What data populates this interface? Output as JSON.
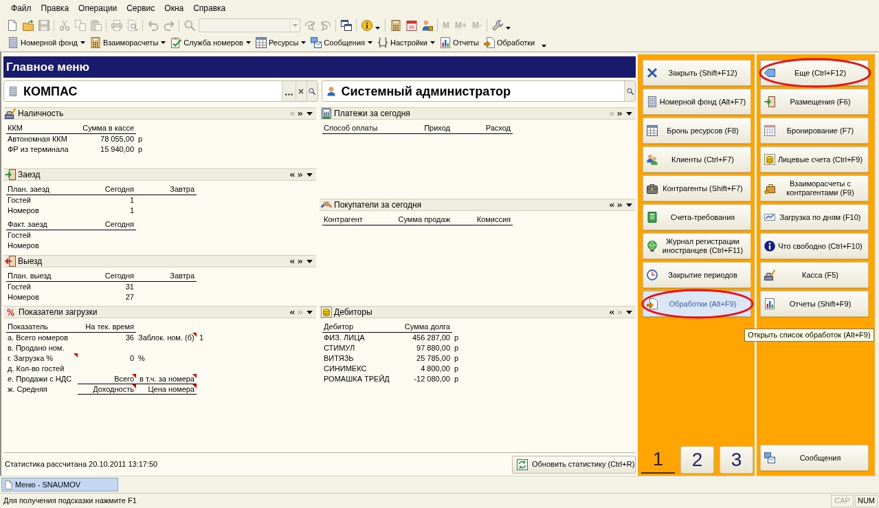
{
  "menu_bar": [
    "Файл",
    "Правка",
    "Операции",
    "Сервис",
    "Окна",
    "Справка"
  ],
  "toolbar": {
    "groups": [
      [
        {
          "kind": "button",
          "disabled": false
        },
        {
          "kind": "button",
          "disabled": false
        },
        {
          "kind": "button",
          "disabled": true
        }
      ],
      [
        {
          "kind": "button",
          "disabled": true
        },
        {
          "kind": "button",
          "disabled": true
        },
        {
          "kind": "button",
          "disabled": true
        }
      ],
      [
        {
          "kind": "button",
          "disabled": true
        },
        {
          "kind": "button",
          "disabled": true
        }
      ],
      [
        {
          "kind": "button",
          "disabled": true
        },
        {
          "kind": "button",
          "disabled": true
        }
      ],
      [
        {
          "kind": "button",
          "disabled": true
        },
        {
          "kind": "combo",
          "disabled": true
        },
        {
          "kind": "button",
          "disabled": true
        },
        {
          "kind": "button",
          "disabled": true
        }
      ],
      [
        {
          "kind": "button",
          "disabled": false
        }
      ],
      [
        {
          "kind": "menu_button",
          "disabled": false
        }
      ],
      [
        {
          "kind": "button",
          "disabled": false
        },
        {
          "kind": "button",
          "disabled": false
        },
        {
          "kind": "button",
          "disabled": false
        }
      ],
      [
        {
          "kind": "text",
          "label": "M",
          "disabled": true
        },
        {
          "kind": "text",
          "label": "M+",
          "disabled": true
        },
        {
          "kind": "text",
          "label": "M-",
          "disabled": true
        }
      ],
      [
        {
          "kind": "menu_button",
          "disabled": false
        }
      ]
    ]
  },
  "nav_toolbar": [
    {
      "label": "Номерной фонд",
      "kind": "menu_button"
    },
    {
      "label": "Взаиморасчеты",
      "kind": "menu_button"
    },
    {
      "label": "Служба номеров",
      "kind": "menu_button"
    },
    {
      "label": "Ресурсы",
      "kind": "menu_button"
    },
    {
      "label": "Сообщения",
      "kind": "menu_button"
    },
    {
      "label": "Настройки",
      "kind": "menu_button"
    },
    {
      "label": "Отчеты",
      "kind": "button"
    },
    {
      "label": "Обработки",
      "kind": "button"
    }
  ],
  "main_menu": {
    "title": "Главное меню",
    "organization_field": {
      "value": "КОМПАС"
    },
    "user_field": {
      "value": "Системный администратор"
    },
    "left_sections": [
      {
        "title": "Наличность",
        "prev_enabled": false,
        "next_enabled": true,
        "tables": [
          {
            "columns": [
              "ККМ",
              "Сумма в кассе"
            ],
            "rows": [
              {
                "cells": [
                  "Автономная ККМ",
                  "78 055,00",
                  "р"
                ]
              },
              {
                "cells": [
                  "ФР из терминала",
                  "15 940,00",
                  "р"
                ]
              }
            ]
          }
        ]
      },
      {
        "title": "Заезд",
        "prev_enabled": true,
        "next_enabled": true,
        "tables": [
          {
            "columns": [
              "План. заезд",
              "Сегодня",
              "Завтра"
            ],
            "rows": [
              {
                "cells": [
                  "Гостей",
                  "1"
                ]
              },
              {
                "cells": [
                  "Номеров",
                  "1"
                ]
              }
            ]
          },
          {
            "columns": [
              "Факт. заезд",
              "Сегодня"
            ],
            "rows": [
              {
                "cells": [
                  "Гостей"
                ]
              },
              {
                "cells": [
                  "Номеров"
                ]
              }
            ]
          }
        ]
      },
      {
        "title": "Выезд",
        "prev_enabled": true,
        "next_enabled": true,
        "tables": [
          {
            "columns": [
              "План. выезд",
              "Сегодня",
              "Завтра"
            ],
            "rows": [
              {
                "cells": [
                  "Гостей",
                  "31"
                ]
              },
              {
                "cells": [
                  "Номеров",
                  "27"
                ]
              }
            ]
          }
        ]
      },
      {
        "title": "Показатели загрузки",
        "prev_enabled": true,
        "next_enabled": false,
        "tables": [
          {
            "columns": [
              "Показатель",
              "На тек. время"
            ],
            "rows": [
              {
                "kind": "data",
                "cells": [
                  {
                    "text": "а. Всего номеров",
                    "marked": false
                  },
                  {
                    "text": "36",
                    "marked": false
                  },
                  {
                    "text": "Заблок. ном. (б)",
                    "marked": true
                  },
                  {
                    "text": "1",
                    "marked": false
                  }
                ]
              },
              {
                "kind": "data",
                "cells": [
                  {
                    "text": "в. Продано ном.",
                    "marked": false
                  }
                ]
              },
              {
                "kind": "data",
                "cells": [
                  {
                    "text": "г. Загрузка %",
                    "marked": true
                  },
                  {
                    "text": "0",
                    "marked": false
                  },
                  {
                    "text": "%",
                    "marked": false
                  }
                ]
              },
              {
                "kind": "data",
                "cells": [
                  {
                    "text": "д. Кол-во гостей",
                    "marked": false
                  }
                ]
              },
              {
                "kind": "subheader",
                "cells": [
                  {
                    "text": "е. Продажи с НДС",
                    "marked": false
                  },
                  {
                    "text": "Всего",
                    "marked": true
                  },
                  {
                    "text": "в т.ч. за номера",
                    "marked": true
                  }
                ]
              },
              {
                "kind": "subheader",
                "cells": [
                  {
                    "text": "ж. Средняя",
                    "marked": false
                  },
                  {
                    "text": "Доходность",
                    "marked": true
                  },
                  {
                    "text": "Цена номера",
                    "marked": true
                  }
                ]
              }
            ]
          }
        ]
      }
    ],
    "right_sections": [
      {
        "title": "Платежи за сегодня",
        "prev_enabled": false,
        "next_enabled": true,
        "tables": [
          {
            "columns": [
              "Способ оплаты",
              "Приход",
              "Расход"
            ]
          }
        ]
      },
      {
        "title": "Покупатели за сегодня",
        "prev_enabled": true,
        "next_enabled": true,
        "tables": [
          {
            "columns": [
              "Контрагент",
              "Сумма продаж",
              "Комиссия"
            ]
          }
        ]
      },
      {
        "title": "Дебиторы",
        "prev_enabled": true,
        "next_enabled": false,
        "tables": [
          {
            "columns": [
              "Дебитор",
              "Сумма долга"
            ],
            "rows": [
              {
                "cells": [
                  "ФИЗ. ЛИЦА",
                  "456 287,00",
                  "р"
                ]
              },
              {
                "cells": [
                  "СТИМУЛ",
                  "97 880,00",
                  "р"
                ]
              },
              {
                "cells": [
                  "ВИТЯЗЬ",
                  "25 785,00",
                  "р"
                ]
              },
              {
                "cells": [
                  "СИНИМЕКС",
                  "4 800,00",
                  "р"
                ]
              },
              {
                "cells": [
                  "РОМАШКА ТРЕЙД",
                  "-12 080,00",
                  "р"
                ]
              }
            ]
          }
        ]
      }
    ],
    "footer": {
      "note": "Статистика рассчитана 20.10.2011 13:17:50",
      "refresh_button": "Обновить статистику (Ctrl+R)"
    }
  },
  "command_panel": {
    "left_buttons": [
      {
        "label": "Закрыть (Shift+F12)",
        "hovered": false,
        "focused": false,
        "circled": false
      },
      {
        "label": "Номерной фонд (Alt+F7)",
        "hovered": false,
        "focused": false,
        "circled": false
      },
      {
        "label": "Бронь ресурсов (F8)",
        "hovered": false,
        "focused": false,
        "circled": false
      },
      {
        "label": "Клиенты (Ctrl+F7)",
        "hovered": false,
        "focused": false,
        "circled": false
      },
      {
        "label": "Контрагенты (Shift+F7)",
        "hovered": false,
        "focused": false,
        "circled": false
      },
      {
        "label": "Счета-требования",
        "hovered": false,
        "focused": false,
        "circled": false
      },
      {
        "label": "Журнал регистрации иностранцев (Ctrl+F11)",
        "hovered": false,
        "focused": false,
        "circled": false
      },
      {
        "label": "Закрытие периодов",
        "hovered": false,
        "focused": false,
        "circled": false
      },
      {
        "label": "Обработки (Alt+F9)",
        "hovered": true,
        "focused": false,
        "circled": true
      }
    ],
    "pages": [
      {
        "label": "1",
        "selected": true
      },
      {
        "label": "2",
        "selected": false
      },
      {
        "label": "3",
        "selected": false
      }
    ],
    "right_buttons": [
      {
        "label": "Еще (Ctrl+F12)",
        "hovered": false,
        "focused": true,
        "circled": true
      },
      {
        "label": "Размещения (F6)",
        "hovered": false,
        "focused": false,
        "circled": false
      },
      {
        "label": "Бронирование (F7)",
        "hovered": false,
        "focused": false,
        "circled": false
      },
      {
        "label": "Лицевые счета (Ctrl+F9)",
        "hovered": false,
        "focused": false,
        "circled": false
      },
      {
        "label": "Взаиморасчеты с контрагентами (F9)",
        "hovered": false,
        "focused": false,
        "circled": false
      },
      {
        "label": "Загрузка по дням (F10)",
        "hovered": false,
        "focused": false,
        "circled": false
      },
      {
        "label": "Что свободно (Ctrl+F10)",
        "hovered": false,
        "focused": false,
        "circled": false
      },
      {
        "label": "Касса (F5)",
        "hovered": false,
        "focused": false,
        "circled": false
      },
      {
        "label": "Отчеты (Shift+F9)",
        "hovered": false,
        "focused": false,
        "circled": false
      }
    ],
    "messages_button": {
      "label": "Сообщения"
    },
    "tooltip": {
      "text": "Открыть список обработок (Alt+F9)"
    }
  },
  "taskbar": [
    {
      "label": "Меню - SNAUMOV",
      "selected": true
    }
  ],
  "status_bar": {
    "hint": "Для получения подсказки нажмите F1",
    "indicators": [
      {
        "label": "CAP",
        "on": false
      },
      {
        "label": "NUM",
        "on": true
      }
    ]
  }
}
